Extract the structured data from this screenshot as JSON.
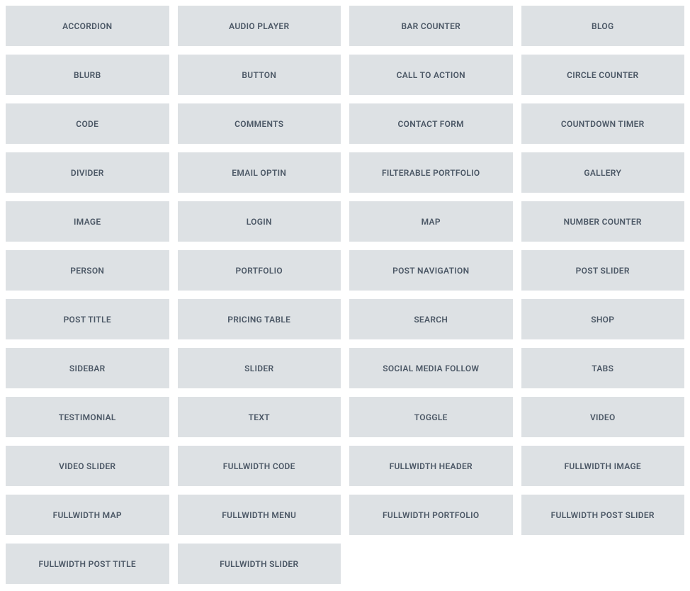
{
  "modules": [
    {
      "id": "accordion",
      "label": "ACCORDION"
    },
    {
      "id": "audio-player",
      "label": "AUDIO PLAYER"
    },
    {
      "id": "bar-counter",
      "label": "BAR COUNTER"
    },
    {
      "id": "blog",
      "label": "BLOG"
    },
    {
      "id": "blurb",
      "label": "BLURB"
    },
    {
      "id": "button",
      "label": "BUTTON"
    },
    {
      "id": "call-to-action",
      "label": "CALL TO ACTION"
    },
    {
      "id": "circle-counter",
      "label": "CIRCLE COUNTER"
    },
    {
      "id": "code",
      "label": "CODE"
    },
    {
      "id": "comments",
      "label": "COMMENTS"
    },
    {
      "id": "contact-form",
      "label": "CONTACT FORM"
    },
    {
      "id": "countdown-timer",
      "label": "COUNTDOWN TIMER"
    },
    {
      "id": "divider",
      "label": "DIVIDER"
    },
    {
      "id": "email-optin",
      "label": "EMAIL OPTIN"
    },
    {
      "id": "filterable-portfolio",
      "label": "FILTERABLE PORTFOLIO"
    },
    {
      "id": "gallery",
      "label": "GALLERY"
    },
    {
      "id": "image",
      "label": "IMAGE"
    },
    {
      "id": "login",
      "label": "LOGIN"
    },
    {
      "id": "map",
      "label": "MAP"
    },
    {
      "id": "number-counter",
      "label": "NUMBER COUNTER"
    },
    {
      "id": "person",
      "label": "PERSON"
    },
    {
      "id": "portfolio",
      "label": "PORTFOLIO"
    },
    {
      "id": "post-navigation",
      "label": "POST NAVIGATION"
    },
    {
      "id": "post-slider",
      "label": "POST SLIDER"
    },
    {
      "id": "post-title",
      "label": "POST TITLE"
    },
    {
      "id": "pricing-table",
      "label": "PRICING TABLE"
    },
    {
      "id": "search",
      "label": "SEARCH"
    },
    {
      "id": "shop",
      "label": "SHOP"
    },
    {
      "id": "sidebar",
      "label": "SIDEBAR"
    },
    {
      "id": "slider",
      "label": "SLIDER"
    },
    {
      "id": "social-media-follow",
      "label": "SOCIAL MEDIA FOLLOW"
    },
    {
      "id": "tabs",
      "label": "TABS"
    },
    {
      "id": "testimonial",
      "label": "TESTIMONIAL"
    },
    {
      "id": "text",
      "label": "TEXT"
    },
    {
      "id": "toggle",
      "label": "TOGGLE"
    },
    {
      "id": "video",
      "label": "VIDEO"
    },
    {
      "id": "video-slider",
      "label": "VIDEO SLIDER"
    },
    {
      "id": "fullwidth-code",
      "label": "FULLWIDTH CODE"
    },
    {
      "id": "fullwidth-header",
      "label": "FULLWIDTH HEADER"
    },
    {
      "id": "fullwidth-image",
      "label": "FULLWIDTH IMAGE"
    },
    {
      "id": "fullwidth-map",
      "label": "FULLWIDTH MAP"
    },
    {
      "id": "fullwidth-menu",
      "label": "FULLWIDTH MENU"
    },
    {
      "id": "fullwidth-portfolio",
      "label": "FULLWIDTH PORTFOLIO"
    },
    {
      "id": "fullwidth-post-slider",
      "label": "FULLWIDTH POST SLIDER"
    },
    {
      "id": "fullwidth-post-title",
      "label": "FULLWIDTH POST TITLE"
    },
    {
      "id": "fullwidth-slider",
      "label": "FULLWIDTH SLIDER"
    }
  ]
}
